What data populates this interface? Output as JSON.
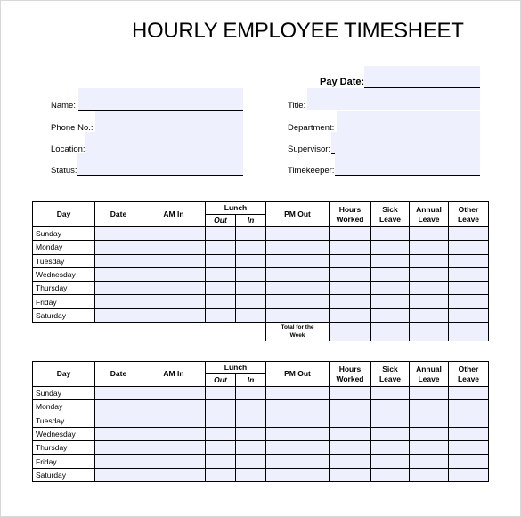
{
  "title": "HOURLY EMPLOYEE TIMESHEET",
  "header_fields": {
    "pay_date": {
      "label": "Pay Date:",
      "value": ""
    },
    "left": [
      {
        "label": "Name:",
        "value": ""
      },
      {
        "label": "Phone No.:",
        "value": ""
      },
      {
        "label": "Location:",
        "value": ""
      },
      {
        "label": "Status:",
        "value": ""
      }
    ],
    "right": [
      {
        "label": "Title:",
        "value": ""
      },
      {
        "label": "Department:",
        "value": ""
      },
      {
        "label": "Supervisor:",
        "value": ""
      },
      {
        "label": "Timekeeper:",
        "value": ""
      }
    ]
  },
  "table": {
    "columns": {
      "day": "Day",
      "date": "Date",
      "am_in": "AM In",
      "lunch": "Lunch",
      "lunch_out": "Out",
      "lunch_in": "In",
      "pm_out": "PM Out",
      "hours_worked_1": "Hours",
      "hours_worked_2": "Worked",
      "sick_1": "Sick",
      "sick_2": "Leave",
      "annual_1": "Annual",
      "annual_2": "Leave",
      "other_1": "Other",
      "other_2": "Leave"
    },
    "days": [
      "Sunday",
      "Monday",
      "Tuesday",
      "Wednesday",
      "Thursday",
      "Friday",
      "Saturday"
    ],
    "total_label_1": "Total for the",
    "total_label_2": "Week"
  },
  "colors": {
    "field_fill": "#eef0fd",
    "border": "#000000"
  }
}
